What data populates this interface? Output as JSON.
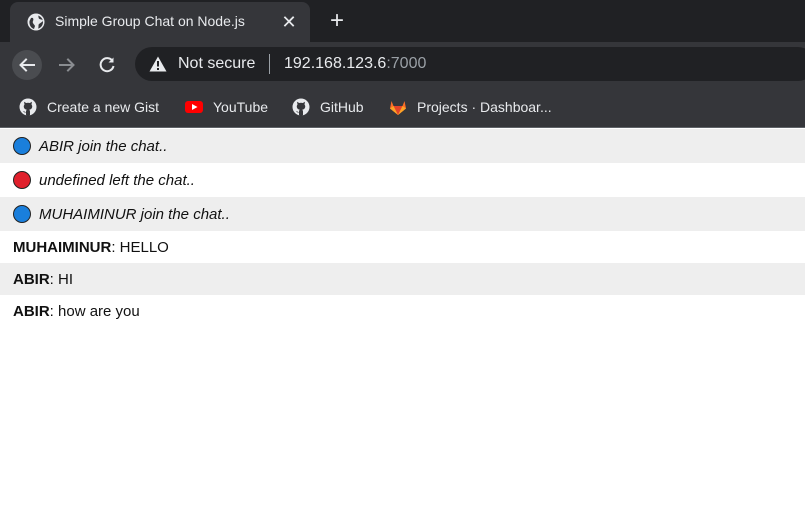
{
  "browser": {
    "tab_title": "Simple Group Chat on Node.js",
    "close_glyph": "✕",
    "newtab_glyph": "+",
    "security_label": "Not secure",
    "url_host": "192.168.123.6",
    "url_port": ":7000",
    "bookmarks": [
      {
        "label": "Create a new Gist",
        "icon": "github-icon"
      },
      {
        "label": "YouTube",
        "icon": "youtube-icon"
      },
      {
        "label": "GitHub",
        "icon": "github-icon"
      },
      {
        "label": "Projects · Dashboar...",
        "icon": "gitlab-icon"
      }
    ]
  },
  "chat": {
    "messages": [
      {
        "type": "system",
        "status": "join",
        "dot_color": "#1a7fdc",
        "text": "ABIR join the chat.."
      },
      {
        "type": "system",
        "status": "left",
        "dot_color": "#e0202c",
        "text": "undefined left the chat.."
      },
      {
        "type": "system",
        "status": "join",
        "dot_color": "#1a7fdc",
        "text": "MUHAIMINUR join the chat.."
      },
      {
        "type": "message",
        "user": "MUHAIMINUR",
        "text": ": HELLO"
      },
      {
        "type": "message",
        "user": "ABIR",
        "text": ": HI"
      },
      {
        "type": "message",
        "user": "ABIR",
        "text": ": how are you"
      }
    ]
  }
}
